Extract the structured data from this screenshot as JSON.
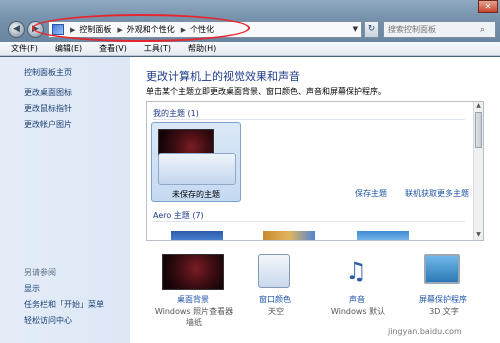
{
  "address_bar": {
    "crumbs": [
      "控制面板",
      "外观和个性化",
      "个性化"
    ]
  },
  "search": {
    "placeholder": "搜索控制面板"
  },
  "menu": [
    "文件(F)",
    "编辑(E)",
    "查看(V)",
    "工具(T)",
    "帮助(H)"
  ],
  "left_pane": {
    "home_link": "控制面板主页",
    "links": [
      "更改桌面图标",
      "更改鼠标指针",
      "更改帐户图片"
    ],
    "see_also_label": "另请参阅",
    "see_also_links": [
      "显示",
      "任务栏和「开始」菜单",
      "轻松访问中心"
    ]
  },
  "main": {
    "title": "更改计算机上的视觉效果和声音",
    "description": "单击某个主题立即更改桌面背景、窗口颜色、声音和屏幕保护程序。",
    "my_themes_heading": "我的主题 (1)",
    "unsaved_theme_name": "未保存的主题",
    "save_theme_link": "保存主题",
    "online_themes_link": "联机获取更多主题",
    "aero_heading": "Aero 主题 (7)"
  },
  "bottom_items": [
    {
      "label": "桌面背景",
      "sub": "Windows 照片查看器墙纸"
    },
    {
      "label": "窗口颜色",
      "sub": "天空"
    },
    {
      "label": "声音",
      "sub": "Windows 默认"
    },
    {
      "label": "屏幕保护程序",
      "sub": "3D 文字"
    }
  ],
  "watermark": "jingyan.baidu.com",
  "colors": {
    "annotation": "#e6262f",
    "link": "#1c52a8",
    "title": "#1e3a8a"
  }
}
